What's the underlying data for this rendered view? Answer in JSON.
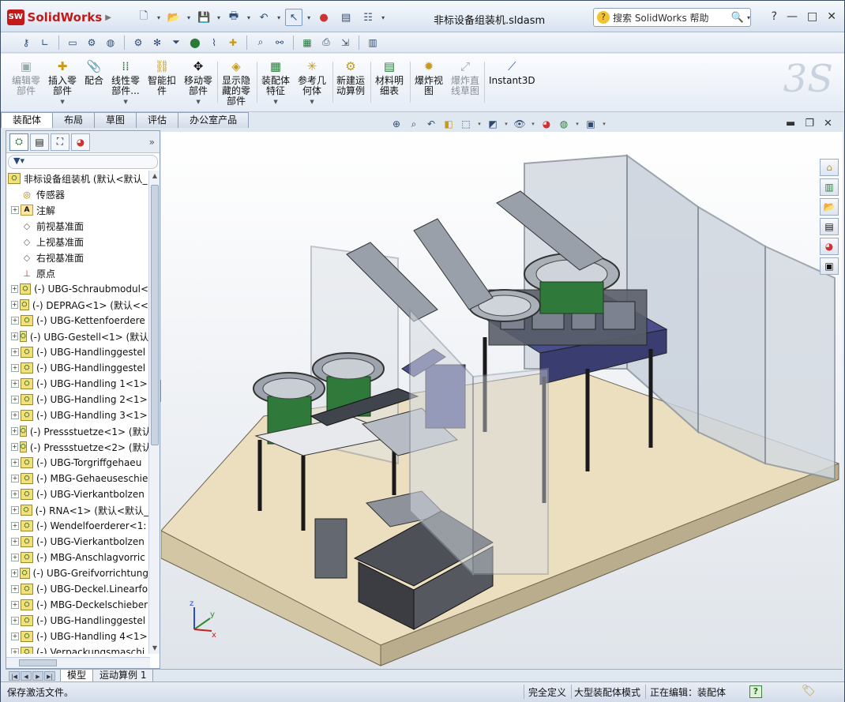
{
  "app": {
    "logo_text": "SolidWorks",
    "logo_badge": "SW",
    "document_title": "非标设备组装机.sldasm",
    "help_search_placeholder": "搜索 SolidWorks 帮助",
    "help_icon": "?",
    "window_controls": [
      "?",
      "—",
      "□",
      "✕"
    ]
  },
  "command_manager": {
    "items": [
      {
        "label": "编辑零部件",
        "line1": "编辑零",
        "line2": "部件",
        "icon": "edit-component-icon",
        "enabled": false
      },
      {
        "label": "插入零部件",
        "line1": "插入零",
        "line2": "部件",
        "icon": "insert-component-icon",
        "enabled": true,
        "dropdown": true
      },
      {
        "label": "配合",
        "line1": "配合",
        "line2": "",
        "icon": "mate-icon",
        "enabled": true
      },
      {
        "label": "线性零部件...",
        "line1": "线性零",
        "line2": "部件...",
        "icon": "linear-pattern-icon",
        "enabled": true,
        "dropdown": true
      },
      {
        "label": "智能扣件",
        "line1": "智能扣",
        "line2": "件",
        "icon": "smart-fastener-icon",
        "enabled": true
      },
      {
        "label": "移动零部件",
        "line1": "移动零",
        "line2": "部件",
        "icon": "move-component-icon",
        "enabled": true,
        "dropdown": true
      },
      {
        "label": "显示隐藏的零部件",
        "line1": "显示隐",
        "line2": "藏的零",
        "line3": "部件",
        "icon": "show-hidden-icon",
        "enabled": true
      },
      {
        "label": "装配体特征",
        "line1": "装配体",
        "line2": "特征",
        "icon": "assembly-feature-icon",
        "enabled": true,
        "dropdown": true
      },
      {
        "label": "参考几何体",
        "line1": "参考几",
        "line2": "何体",
        "icon": "reference-geometry-icon",
        "enabled": true,
        "dropdown": true
      },
      {
        "label": "新建运动算例",
        "line1": "新建运",
        "line2": "动算例",
        "icon": "motion-study-icon",
        "enabled": true
      },
      {
        "label": "材料明细表",
        "line1": "材料明",
        "line2": "细表",
        "icon": "bom-icon",
        "enabled": true
      },
      {
        "label": "爆炸视图",
        "line1": "爆炸视",
        "line2": "图",
        "icon": "explode-view-icon",
        "enabled": true
      },
      {
        "label": "爆炸直线草图",
        "line1": "爆炸直",
        "line2": "线草图",
        "icon": "explode-line-sketch-icon",
        "enabled": false
      },
      {
        "label": "Instant3D",
        "line1": "Instant3D",
        "line2": "",
        "icon": "instant3d-icon",
        "enabled": true
      }
    ]
  },
  "tabs": [
    "装配体",
    "布局",
    "草图",
    "评估",
    "办公室产品"
  ],
  "active_tab": "装配体",
  "feature_tree": {
    "root": "非标设备组装机 (默认<默认_",
    "items": [
      {
        "label": "传感器",
        "type": "sensor",
        "expand": false
      },
      {
        "label": "注解",
        "type": "note",
        "expand": true
      },
      {
        "label": "前视基准面",
        "type": "plane",
        "expand": false
      },
      {
        "label": "上视基准面",
        "type": "plane",
        "expand": false
      },
      {
        "label": "右视基准面",
        "type": "plane",
        "expand": false
      },
      {
        "label": "原点",
        "type": "origin",
        "expand": false
      },
      {
        "label": "(-) UBG-Schraubmodul<",
        "type": "part",
        "expand": true
      },
      {
        "label": "(-) DEPRAG<1> (默认<<",
        "type": "part",
        "expand": true
      },
      {
        "label": "(-) UBG-Kettenfoerdere",
        "type": "part",
        "expand": true
      },
      {
        "label": "(-) UBG-Gestell<1> (默认",
        "type": "part",
        "expand": true
      },
      {
        "label": "(-) UBG-Handlinggestel",
        "type": "part",
        "expand": true
      },
      {
        "label": "(-) UBG-Handlinggestel",
        "type": "part",
        "expand": true
      },
      {
        "label": "(-) UBG-Handling 1<1>",
        "type": "part",
        "expand": true
      },
      {
        "label": "(-) UBG-Handling 2<1>",
        "type": "part",
        "expand": true
      },
      {
        "label": "(-) UBG-Handling 3<1>",
        "type": "part",
        "expand": true
      },
      {
        "label": "(-) Pressstuetze<1> (默认",
        "type": "part",
        "expand": true
      },
      {
        "label": "(-) Pressstuetze<2> (默认",
        "type": "part",
        "expand": true
      },
      {
        "label": "(-) UBG-Torgriffgehaeu",
        "type": "part",
        "expand": true
      },
      {
        "label": "(-) MBG-Gehaeuseschie",
        "type": "part",
        "expand": true
      },
      {
        "label": "(-) UBG-Vierkantbolzen",
        "type": "part",
        "expand": true
      },
      {
        "label": "(-) RNA<1> (默认<默认_",
        "type": "part",
        "expand": true
      },
      {
        "label": "(-) Wendelfoerderer<1:",
        "type": "part",
        "expand": true
      },
      {
        "label": "(-) UBG-Vierkantbolzen",
        "type": "part",
        "expand": true
      },
      {
        "label": "(-) MBG-Anschlagvorric",
        "type": "part",
        "expand": true
      },
      {
        "label": "(-) UBG-Greifvorrichtung",
        "type": "part",
        "expand": true
      },
      {
        "label": "(-) UBG-Deckel.Linearfo",
        "type": "part",
        "expand": true
      },
      {
        "label": "(-) MBG-Deckelschieber",
        "type": "part",
        "expand": true
      },
      {
        "label": "(-) UBG-Handlinggestel",
        "type": "part",
        "expand": true
      },
      {
        "label": "(-) UBG-Handling 4<1>",
        "type": "part",
        "expand": true
      },
      {
        "label": "(-) Verpackungsmaschi",
        "type": "part",
        "expand": true
      }
    ]
  },
  "bottom_tabs": [
    "模型",
    "运动算例 1"
  ],
  "active_bottom_tab": "模型",
  "status": {
    "left": "保存激活文件。",
    "definition": "完全定义",
    "mode": "大型装配体模式",
    "editing": "正在编辑：装配体"
  },
  "triad": {
    "x": "x",
    "y": "y",
    "z": "z"
  },
  "colors": {
    "frame_blue": "#4a4e8a",
    "bowl_green": "#2f7a3a",
    "floor": "#ecdfbf",
    "glass": "#c9d2dc"
  }
}
